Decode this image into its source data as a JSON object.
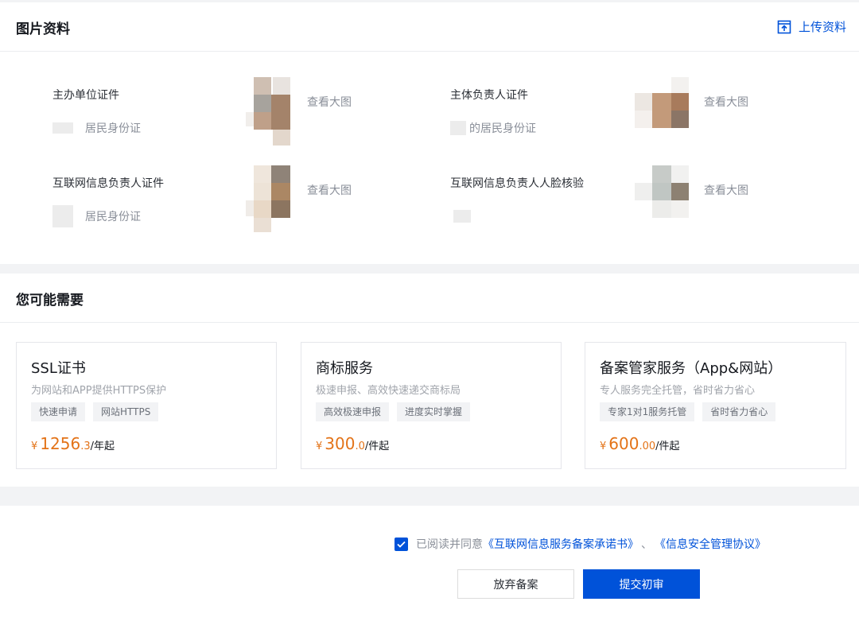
{
  "docs_panel": {
    "title": "图片资料",
    "upload_label": "上传资料",
    "view_label": "查看大图",
    "items": [
      {
        "label": "主办单位证件",
        "sub": "居民身份证"
      },
      {
        "label": "主体负责人证件",
        "sub": "的居民身份证"
      },
      {
        "label": "互联网信息负责人证件",
        "sub": "居民身份证"
      },
      {
        "label": "互联网信息负责人人脸核验",
        "sub": ""
      }
    ]
  },
  "recommend_panel": {
    "title": "您可能需要",
    "cards": [
      {
        "title": "SSL证书",
        "desc": "为网站和APP提供HTTPS保护",
        "tags": [
          "快速申请",
          "网站HTTPS"
        ],
        "currency": "¥",
        "price_int": "1256",
        "price_dec": ".3",
        "unit": "/年起"
      },
      {
        "title": "商标服务",
        "desc": "极速申报、高效快速递交商标局",
        "tags": [
          "高效极速申报",
          "进度实时掌握"
        ],
        "currency": "¥",
        "price_int": "300",
        "price_dec": ".0",
        "unit": "/件起"
      },
      {
        "title": "备案管家服务（App&网站）",
        "desc": "专人服务完全托管，省时省力省心",
        "tags": [
          "专家1对1服务托管",
          "省时省力省心"
        ],
        "currency": "¥",
        "price_int": "600",
        "price_dec": ".00",
        "unit": "/件起"
      }
    ]
  },
  "footer": {
    "agree_checked": true,
    "agree_text": "已阅读并同意",
    "agree_link1": "《互联网信息服务备案承诺书》",
    "agree_sep": "、",
    "agree_link2": "《信息安全管理协议》",
    "cancel_label": "放弃备案",
    "submit_label": "提交初审"
  },
  "colors": {
    "primary": "#0052d9",
    "price": "#e37318",
    "muted": "#8a8f99",
    "page_bg": "#f2f3f5"
  }
}
